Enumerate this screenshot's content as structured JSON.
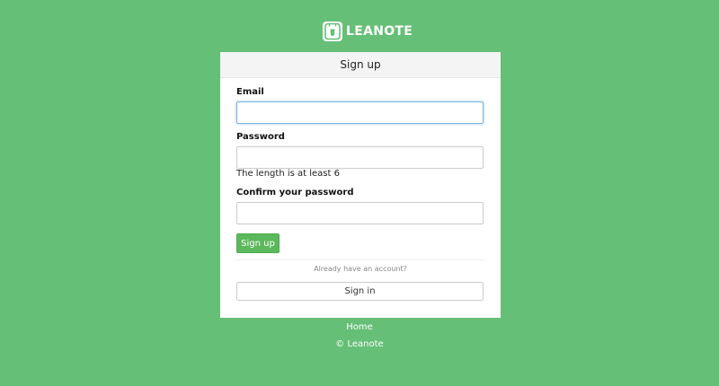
{
  "brand": {
    "logo_icon": "leanote-logo-icon",
    "name": "LEANOTE",
    "background_color": "#66bf77"
  },
  "signup_form": {
    "title": "Sign up",
    "email": {
      "label": "Email",
      "value": "",
      "placeholder": ""
    },
    "password": {
      "label": "Password",
      "value": "",
      "placeholder": "",
      "hint": "The length is at least 6"
    },
    "confirm_password": {
      "label": "Confirm your password",
      "value": "",
      "placeholder": ""
    },
    "submit_label": "Sign up",
    "submit_color": "#5cb85c",
    "already_text": "Already have an account?",
    "signin_label": "Sign in"
  },
  "footer": {
    "home_label": "Home",
    "copyright": "© Leanote"
  }
}
